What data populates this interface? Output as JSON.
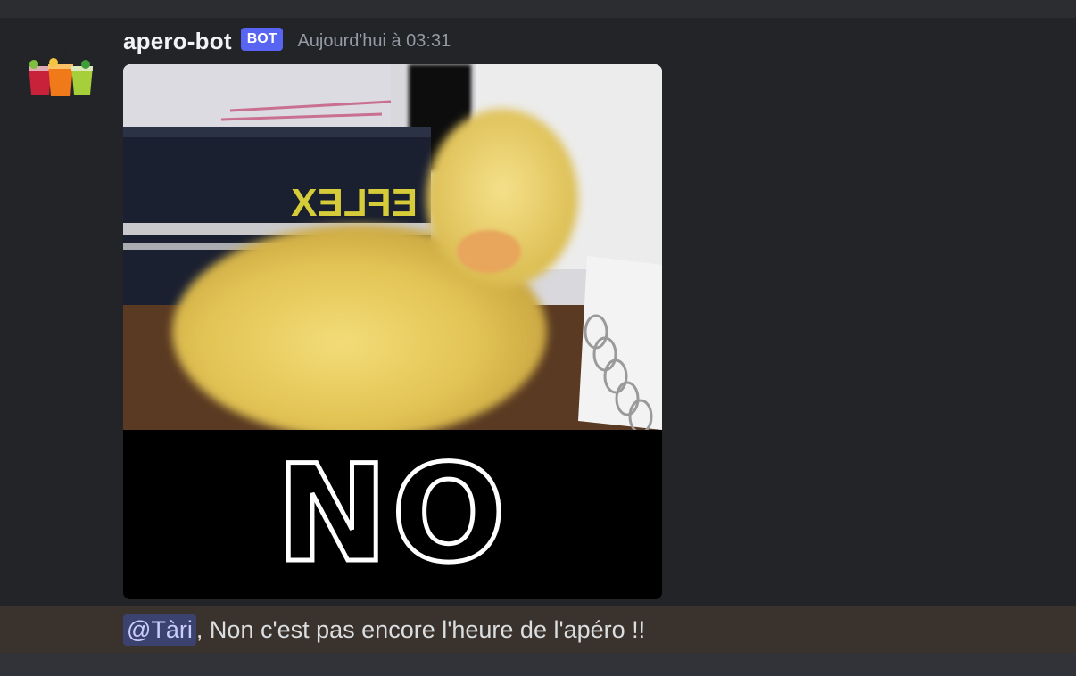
{
  "message": {
    "username": "apero-bot",
    "badge": "BOT",
    "timestamp": "Aujourd'hui à 03:31",
    "avatar_icon": "cocktail-glasses-avatar",
    "attachment": {
      "type": "gif",
      "overlay_text": "NO",
      "background_text": "EFLEX"
    },
    "mention": "@Tàri",
    "text": ", Non c'est pas encore l'heure de l'apéro !!"
  },
  "colors": {
    "background": "#313338",
    "message_bg": "#232428",
    "mention_highlight": "#3a322c",
    "badge": "#5865f2",
    "mention_pill": "#3c4270"
  }
}
